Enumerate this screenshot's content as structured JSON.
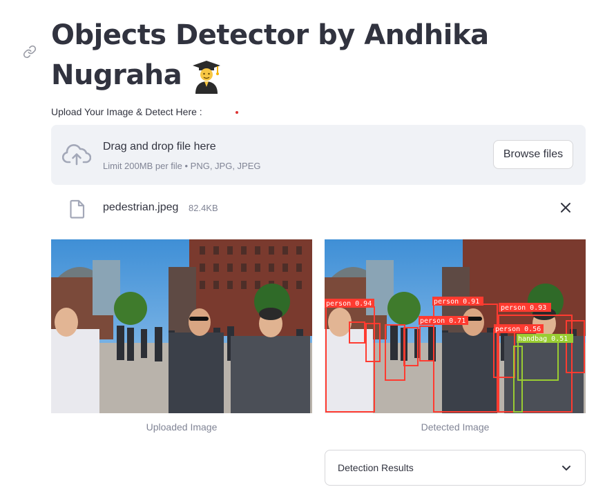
{
  "page": {
    "title": "Objects Detector by Andhika Nugraha",
    "title_emoji": "student-emoji"
  },
  "uploader": {
    "label": "Upload Your Image & Detect Here :",
    "drop_title": "Drag and drop file here",
    "drop_limits": "Limit 200MB per file • PNG, JPG, JPEG",
    "browse_label": "Browse files"
  },
  "file": {
    "name": "pedestrian.jpeg",
    "size": "82.4KB"
  },
  "images": {
    "uploaded_caption": "Uploaded Image",
    "detected_caption": "Detected Image"
  },
  "detections": {
    "box_colors": {
      "person": "#ff3b30",
      "handbag": "#9acd32"
    },
    "labels": [
      "person 0.94",
      "person 0.91",
      "person 0.93",
      "person 0.71",
      "person 0.56",
      "handbag 0.51"
    ]
  },
  "results": {
    "expander_label": "Detection Results"
  },
  "colors": {
    "text": "#31333f",
    "muted": "#808495",
    "dropzone_bg": "#f0f2f6",
    "border": "#d6d6d9"
  }
}
